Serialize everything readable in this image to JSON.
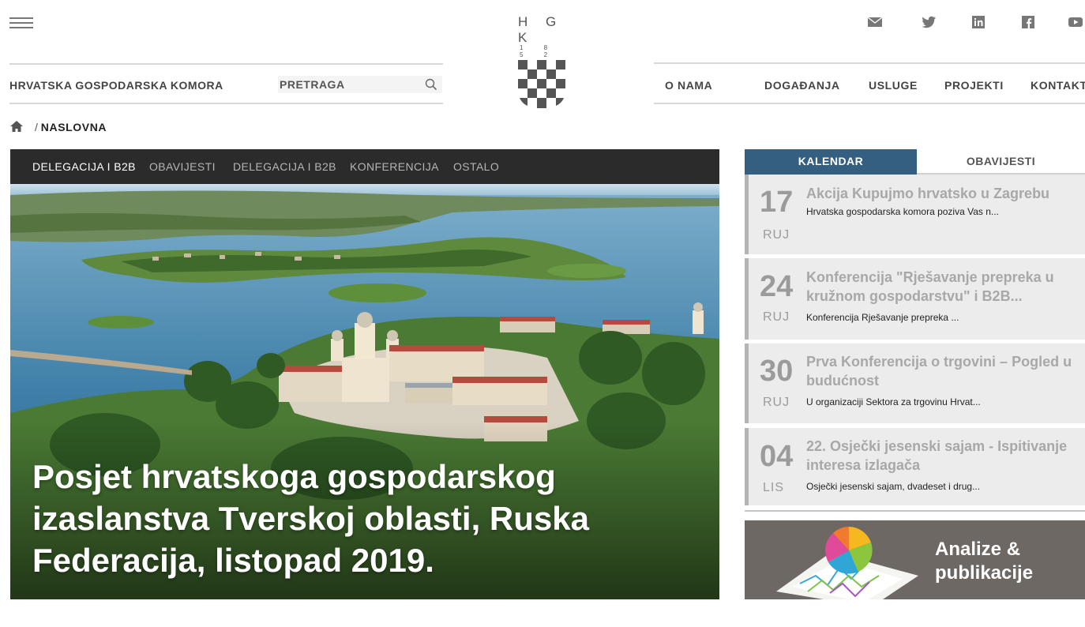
{
  "header": {
    "menu_icon": "hamburger-menu-icon",
    "org_name": "HRVATSKA GOSPODARSKA KOMORA",
    "search": {
      "placeholder": "PRETRAGA",
      "icon": "search-icon"
    },
    "logo": {
      "letters": "H G K",
      "year": "1 8 5 2"
    },
    "nav": [
      "O NAMA",
      "DOGAĐANJA",
      "USLUGE",
      "PROJEKTI",
      "KONTAKT"
    ],
    "social": [
      "mail-icon",
      "twitter-icon",
      "linkedin-icon",
      "facebook-icon",
      "youtube-icon"
    ]
  },
  "breadcrumb": {
    "home_icon": "home-icon",
    "separator": "/",
    "current": "NASLOVNA"
  },
  "hero": {
    "tabs": [
      "DELEGACIJA I B2B",
      "OBAVIJESTI",
      "DELEGACIJA I B2B",
      "KONFERENCIJA",
      "OSTALO"
    ],
    "active_tab": 0,
    "title": "Posjet hrvatskoga gospodarskog izaslanstva Tverskoj oblasti, Ruska Federacija, listopad 2019."
  },
  "sidebar": {
    "tabs": [
      "KALENDAR",
      "OBAVIJESTI"
    ],
    "active_tab": 0,
    "events": [
      {
        "day": "17",
        "month": "RUJ",
        "title": "Akcija Kupujmo hrvatsko u Zagrebu",
        "summary": "Hrvatska gospodarska komora poziva Vas n..."
      },
      {
        "day": "24",
        "month": "RUJ",
        "title": "Konferencija \"Rješavanje prepreka u kružnom gospodarstvu\" i B2B...",
        "summary": "Konferencija Rješavanje prepreka ..."
      },
      {
        "day": "30",
        "month": "RUJ",
        "title": "Prva Konferencija o trgovini – Pogled u budućnost",
        "summary": "U organizaciji Sektora za trgovinu Hrvat..."
      },
      {
        "day": "04",
        "month": "LIS",
        "title": "22. Osječki jesenski sajam - Ispitivanje interesa izlagača",
        "summary": "Osječki jesenski sajam, dvadeset i drug..."
      }
    ],
    "promo": {
      "line1": "Analize &",
      "line2": "publikacije"
    }
  },
  "colors": {
    "tab_active": "#355f80",
    "hero_tabs_bg": "#2b2b2b",
    "promo_bg": "#6e6864",
    "event_bg": "#ececec"
  }
}
